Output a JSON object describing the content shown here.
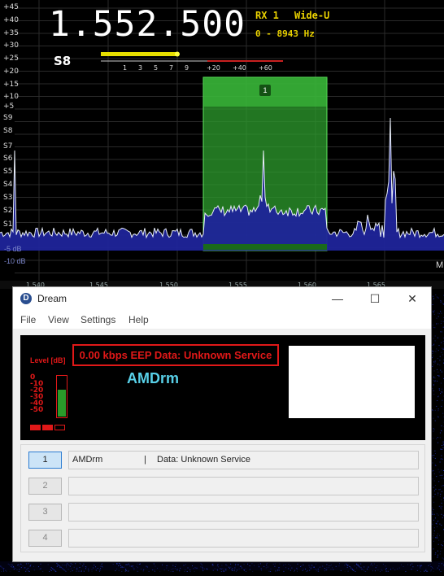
{
  "sdr": {
    "frequency": "1.552.500",
    "rx": "RX 1",
    "mode": "Wide-U",
    "bandwidth": "0 - 8943 Hz",
    "smeter_value": "S8",
    "smeter_ticks": [
      "1",
      "3",
      "5",
      "7",
      "9",
      "+20",
      "+40",
      "+60"
    ],
    "db_scale": [
      "+45",
      "+40",
      "+35",
      "+30",
      "+25",
      "+20",
      "+15",
      "+10",
      "+5",
      "S9",
      "S8",
      "S7",
      "S6",
      "S5",
      "S4",
      "S3",
      "S2",
      "S1"
    ],
    "db_bottom": [
      "-5 dB",
      "-10 dB"
    ],
    "freq_axis": [
      "1.540",
      "1.545",
      "1.550",
      "1.555",
      "1.560",
      "1.565"
    ],
    "axis_right_label": "M",
    "vfo_marker": "1",
    "colors": {
      "filter_passband": "#3fd03f",
      "spectrum_fill": "#1a1f8a",
      "smeter_bar": "#e8e000",
      "smeter_over": "#c82020"
    }
  },
  "dream": {
    "app_icon": "D",
    "title": "Dream",
    "window_buttons": {
      "minimize": "—",
      "maximize": "☐",
      "close": "✕"
    },
    "menu": [
      "File",
      "View",
      "Settings",
      "Help"
    ],
    "level_label": "Level [dB]",
    "level_ticks": [
      "0",
      "-10",
      "-20",
      "-30",
      "-40",
      "-50"
    ],
    "level_fraction": 0.65,
    "status_text": "0.00 kbps EEP  Data:  Unknown Service",
    "service_label": "AMDrm",
    "services": [
      {
        "number": "1",
        "name": "AMDrm",
        "separator": "|",
        "data": "Data: Unknown Service",
        "active": true
      },
      {
        "number": "2",
        "name": "",
        "separator": "",
        "data": "",
        "active": false
      },
      {
        "number": "3",
        "name": "",
        "separator": "",
        "data": "",
        "active": false
      },
      {
        "number": "4",
        "name": "",
        "separator": "",
        "data": "",
        "active": false
      }
    ]
  }
}
